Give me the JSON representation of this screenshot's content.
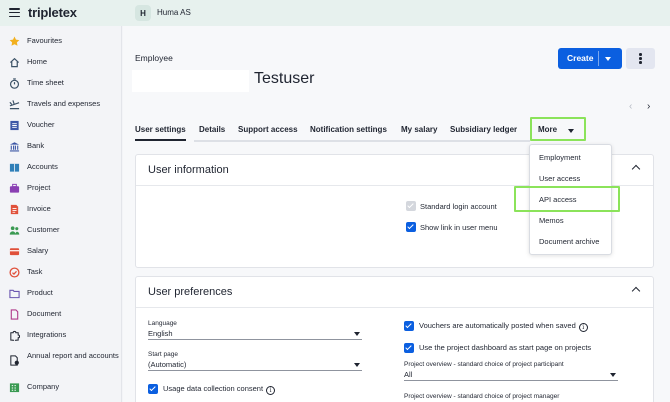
{
  "topbar": {
    "logo": "tripletex",
    "company_initial": "H",
    "company_name": "Huma AS"
  },
  "sidebar": {
    "items": [
      {
        "label": "Favourites",
        "icon": "star-icon"
      },
      {
        "label": "Home",
        "icon": "home-icon"
      },
      {
        "label": "Time sheet",
        "icon": "stopwatch-icon"
      },
      {
        "label": "Travels and expenses",
        "icon": "plane-icon"
      },
      {
        "label": "Voucher",
        "icon": "voucher-icon"
      },
      {
        "label": "Bank",
        "icon": "bank-icon"
      },
      {
        "label": "Accounts",
        "icon": "book-icon"
      },
      {
        "label": "Project",
        "icon": "briefcase-icon"
      },
      {
        "label": "Invoice",
        "icon": "invoice-icon"
      },
      {
        "label": "Customer",
        "icon": "people-icon"
      },
      {
        "label": "Salary",
        "icon": "wallet-icon"
      },
      {
        "label": "Task",
        "icon": "check-circle-icon"
      },
      {
        "label": "Product",
        "icon": "folder-icon"
      },
      {
        "label": "Document",
        "icon": "document-icon"
      },
      {
        "label": "Integrations",
        "icon": "puzzle-icon"
      },
      {
        "label": "Annual report and accounts",
        "icon": "report-icon"
      },
      {
        "label": "Company",
        "icon": "building-icon"
      }
    ]
  },
  "header": {
    "caption": "Employee",
    "title": "Testuser",
    "create_label": "Create"
  },
  "tabs": [
    {
      "label": "User settings"
    },
    {
      "label": "Details"
    },
    {
      "label": "Support access"
    },
    {
      "label": "Notification settings"
    },
    {
      "label": "My salary"
    },
    {
      "label": "Subsidiary ledger"
    },
    {
      "label": "More"
    }
  ],
  "more_menu": {
    "items": [
      "Employment",
      "User access",
      "API access",
      "Memos",
      "Document archive"
    ]
  },
  "user_information": {
    "title": "User information",
    "standard_login": "Standard login account",
    "show_link": "Show link in user menu"
  },
  "user_preferences": {
    "title": "User preferences",
    "language_label": "Language",
    "language_value": "English",
    "start_page_label": "Start page",
    "start_page_value": "(Automatic)",
    "usage_consent": "Usage data collection consent",
    "vouchers_posted": "Vouchers are automatically posted when saved",
    "project_dashboard": "Use the project dashboard as start page on projects",
    "participant_label": "Project overview - standard choice of project participant",
    "participant_value": "All",
    "manager_label": "Project overview - standard choice of project manager"
  },
  "colors": {
    "primary": "#0b5fe0",
    "highlight": "#8be35a",
    "topbar": "#e7f1ee"
  }
}
